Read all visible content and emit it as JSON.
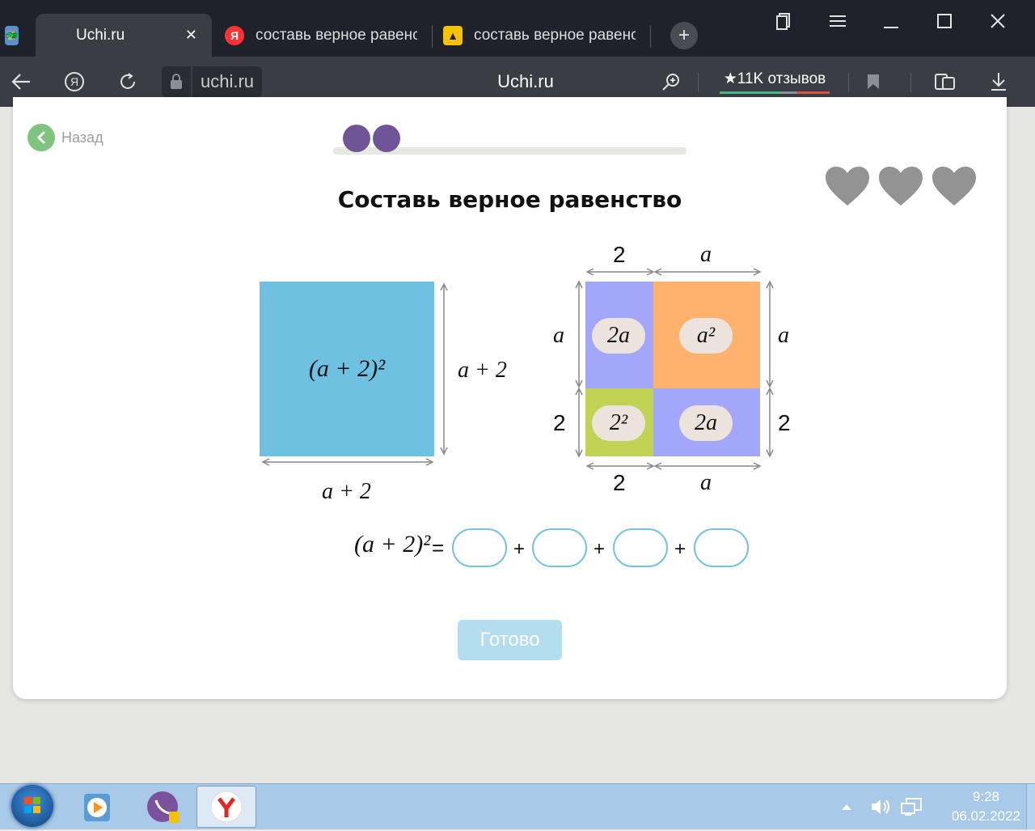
{
  "browser": {
    "tabs": [
      {
        "label": "Uchi.ru",
        "active": true
      },
      {
        "label": "составь верное равенс",
        "active": false
      },
      {
        "label": "составь верное равенс",
        "active": false
      }
    ],
    "address": "uchi.ru",
    "page_title": "Uchi.ru",
    "reviews": "★11K отзывов"
  },
  "page": {
    "back_label": "Назад",
    "title": "Составь верное равенство",
    "progress_dots": 2,
    "lives": 3,
    "done_label": "Готово"
  },
  "figure": {
    "big_square_expr": "(a + 2)²",
    "side_label": "a + 2",
    "bottom_label": "a + 2",
    "top_labels": [
      "2",
      "a"
    ],
    "bottom_labels": [
      "2",
      "a"
    ],
    "left_labels": [
      "a",
      "2"
    ],
    "right_labels": [
      "a",
      "2"
    ],
    "chips": [
      "2a",
      "a²",
      "2²",
      "2a"
    ],
    "colors": {
      "square": "#6ec1e0",
      "purple": "#a3a7fb",
      "orange": "#ffb26e",
      "green": "#c0d354"
    }
  },
  "equation": {
    "lhs": "(a + 2)²",
    "equals": "=",
    "plus": "+",
    "slots": 4
  },
  "taskbar": {
    "time": "9:28",
    "date": "06.02.2022"
  }
}
